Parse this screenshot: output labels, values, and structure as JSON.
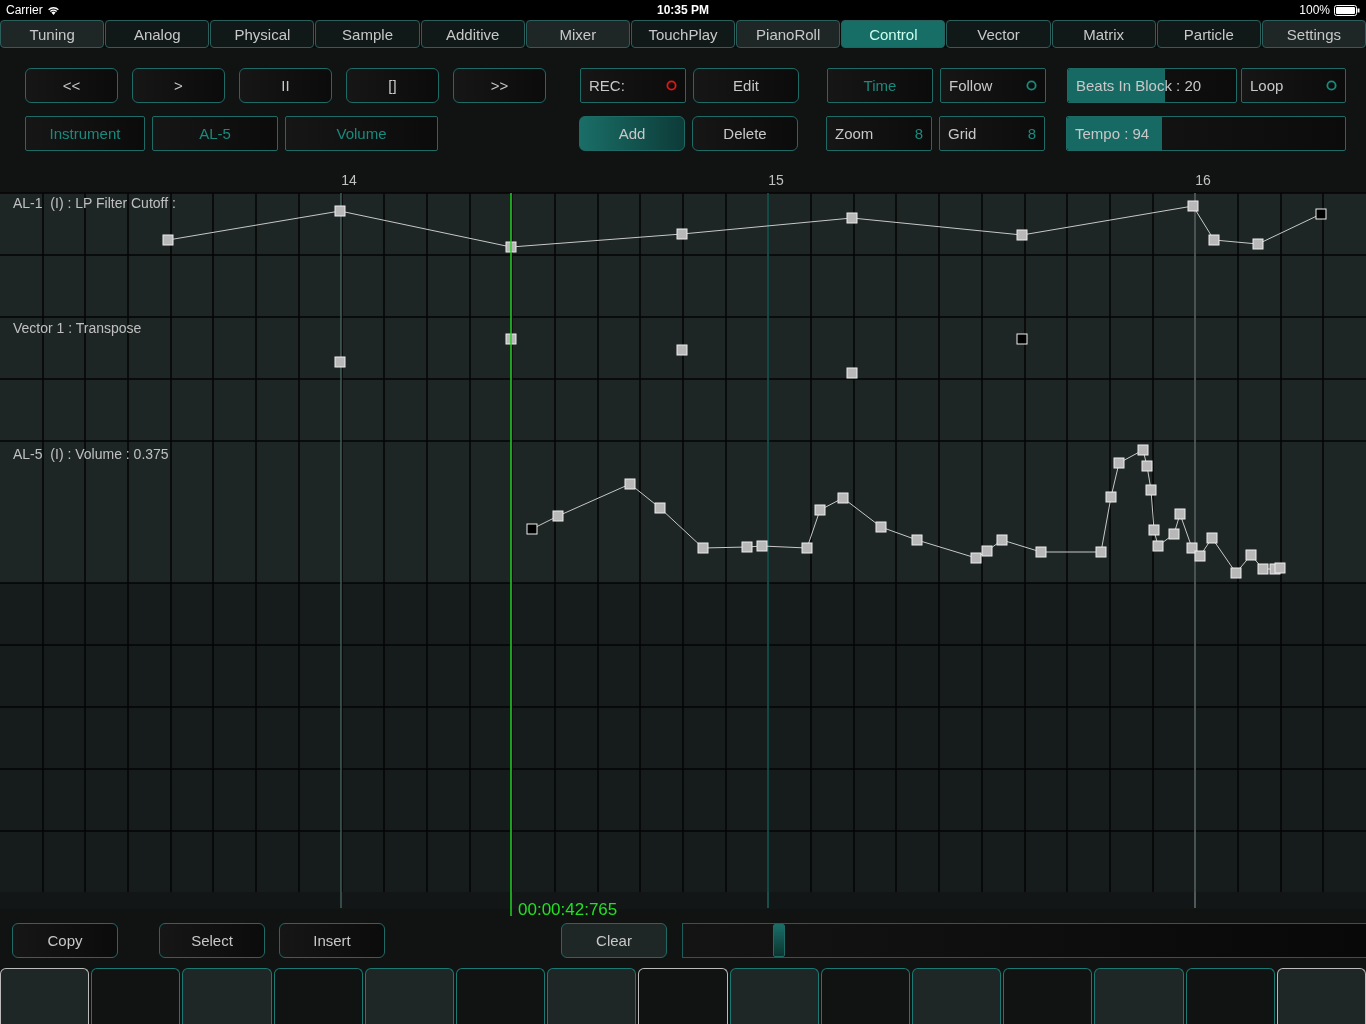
{
  "status_bar": {
    "carrier": "Carrier",
    "time": "10:35 PM",
    "battery": "100%"
  },
  "tabs": [
    {
      "label": "Tuning",
      "selected": false,
      "highlighted": true
    },
    {
      "label": "Analog",
      "selected": false,
      "highlighted": false
    },
    {
      "label": "Physical",
      "selected": false,
      "highlighted": false
    },
    {
      "label": "Sample",
      "selected": false,
      "highlighted": false
    },
    {
      "label": "Additive",
      "selected": false,
      "highlighted": false
    },
    {
      "label": "Mixer",
      "selected": false,
      "highlighted": true
    },
    {
      "label": "TouchPlay",
      "selected": false,
      "highlighted": false
    },
    {
      "label": "PianoRoll",
      "selected": false,
      "highlighted": true
    },
    {
      "label": "Control",
      "selected": true,
      "highlighted": false
    },
    {
      "label": "Vector",
      "selected": false,
      "highlighted": false
    },
    {
      "label": "Matrix",
      "selected": false,
      "highlighted": false
    },
    {
      "label": "Particle",
      "selected": false,
      "highlighted": false
    },
    {
      "label": "Settings",
      "selected": false,
      "highlighted": true
    }
  ],
  "toolbar": [
    [
      {
        "kind": "transport",
        "label": "<<"
      },
      {
        "kind": "transport",
        "label": ">"
      },
      {
        "kind": "transport",
        "label": "II"
      },
      {
        "kind": "transport",
        "label": "[]"
      },
      {
        "kind": "transport",
        "label": ">>"
      },
      {
        "kind": "toggle",
        "label": "REC:",
        "on": false,
        "color": "#e01818"
      },
      {
        "kind": "button",
        "label": "Edit",
        "active": false
      },
      {
        "kind": "label",
        "label": "Time"
      },
      {
        "kind": "toggle",
        "label": "Follow",
        "on": false,
        "color": "#1a8a7c"
      },
      {
        "kind": "slider",
        "label": "Beats In Block : 20",
        "level": 0.58
      },
      {
        "kind": "toggle",
        "label": "Loop",
        "on": false,
        "color": "#1a8a7c"
      }
    ],
    [
      {
        "kind": "label",
        "label": "Instrument"
      },
      {
        "kind": "label",
        "label": "AL-5"
      },
      {
        "kind": "label",
        "label": "Volume"
      },
      {
        "kind": "button",
        "label": "Add",
        "active": true
      },
      {
        "kind": "button",
        "label": "Delete",
        "active": false
      },
      {
        "kind": "value",
        "label": "Zoom",
        "value": "8"
      },
      {
        "kind": "value",
        "label": "Grid",
        "value": "8"
      },
      {
        "kind": "slider",
        "label": "Tempo : 94",
        "level": 0.34
      }
    ]
  ],
  "ruler": [
    "14",
    "15",
    "16"
  ],
  "lanes": [
    {
      "label": "AL-1  (I) : LP Filter Cutoff :"
    },
    {
      "label": "Vector 1 : Transpose"
    },
    {
      "label": "AL-5  (I) : Volume : 0.375"
    }
  ],
  "playhead_time": "00:00:42:765",
  "bottom_buttons": [
    {
      "label": "Copy",
      "highlighted": false
    },
    {
      "label": "Select",
      "highlighted": false
    },
    {
      "label": "Insert",
      "highlighted": false
    },
    {
      "label": "Clear",
      "highlighted": true
    }
  ],
  "position_slider": {
    "level": 0.14
  },
  "pads": [
    {
      "selected": true
    },
    {
      "selected": false
    },
    {
      "selected": false
    },
    {
      "selected": false
    },
    {
      "selected": false
    },
    {
      "selected": false
    },
    {
      "selected": false
    },
    {
      "selected": true
    },
    {
      "selected": false
    },
    {
      "selected": false
    },
    {
      "selected": false
    },
    {
      "selected": false
    },
    {
      "selected": false
    },
    {
      "selected": false
    },
    {
      "selected": true
    }
  ]
}
